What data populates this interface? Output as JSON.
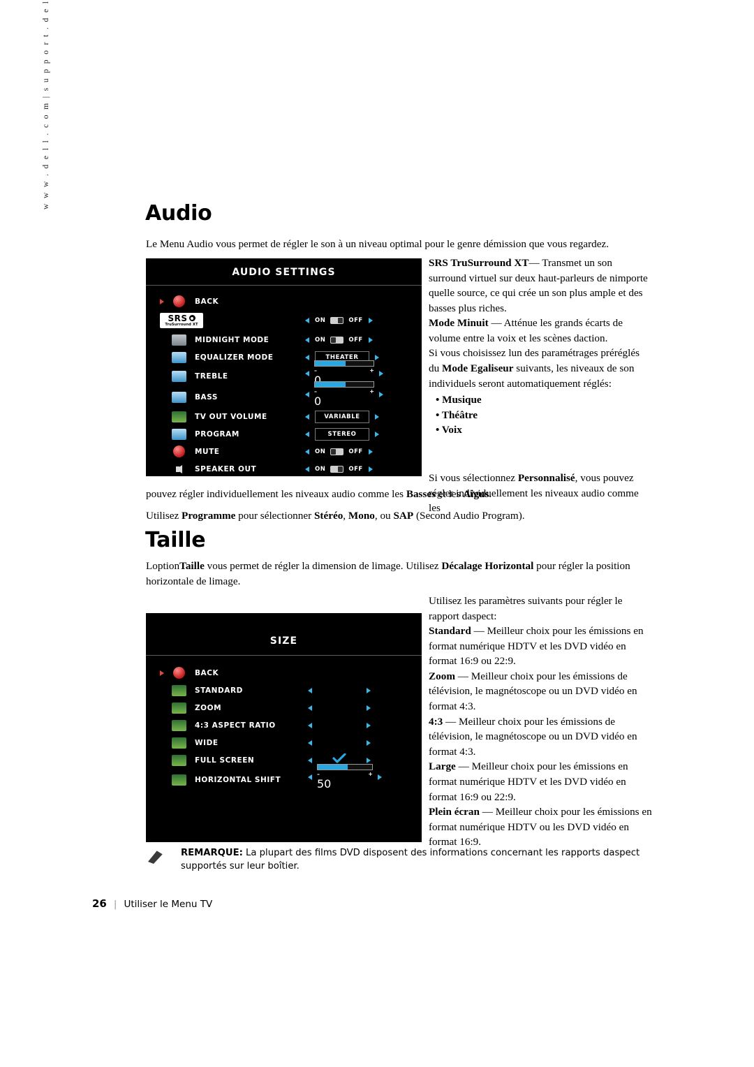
{
  "side_url": "w w w . d e l l . c o m  |  s u p p o r t . d e l l . c o m",
  "sections": {
    "audio": {
      "heading": "Audio",
      "intro": "Le Menu Audio vous permet de régler le son à un niveau optimal pour le genre démission que vous regardez.",
      "osd": {
        "title": "AUDIO SETTINGS",
        "rows": [
          {
            "label": "BACK",
            "icon": "back-icon",
            "control": "none"
          },
          {
            "label": "",
            "icon": "srs-trusurround-logo",
            "control": "onoff",
            "value": "ON",
            "on_label": "ON",
            "off_label": "OFF"
          },
          {
            "label": "MIDNIGHT MODE",
            "icon": "midnight-mode-icon",
            "control": "onoff",
            "value": "OFF",
            "on_label": "ON",
            "off_label": "OFF"
          },
          {
            "label": "EQUALIZER MODE",
            "icon": "equalizer-icon",
            "control": "box",
            "value": "THEATER"
          },
          {
            "label": "TREBLE",
            "icon": "treble-icon",
            "control": "slider",
            "value": "0",
            "minus": "–",
            "plus": "+",
            "fill": 52
          },
          {
            "label": "BASS",
            "icon": "bass-icon",
            "control": "slider",
            "value": "0",
            "minus": "–",
            "plus": "+",
            "fill": 52
          },
          {
            "label": "TV OUT VOLUME",
            "icon": "tv-out-volume-icon",
            "control": "box",
            "value": "VARIABLE"
          },
          {
            "label": "PROGRAM",
            "icon": "program-icon",
            "control": "box",
            "value": "STEREO"
          },
          {
            "label": "MUTE",
            "icon": "mute-icon",
            "control": "onoff",
            "value": "OFF",
            "on_label": "ON",
            "off_label": "OFF"
          },
          {
            "label": "SPEAKER OUT",
            "icon": "speaker-out-icon",
            "control": "onoff",
            "value": "ON",
            "on_label": "ON",
            "off_label": "OFF"
          }
        ]
      },
      "right_col": {
        "p1_bold": "SRS TruSurround XT",
        "p1_rest": "— Transmet un son surround virtuel sur deux haut-parleurs de nimporte quelle source, ce qui crée un son plus ample et des basses plus riches.",
        "p2_bold": "Mode Minuit",
        "p2_rest": "— Atténue les grands écarts de volume entre la voix et les scènes daction.",
        "p3_pre": "Si vous choisissez lun des paramétrages préréglés du ",
        "p3_bold": "Mode Egaliseur",
        "p3_post": " suivants, les niveaux de son individuels seront automatiquement réglés:",
        "bullets": [
          "Musique",
          "Théâtre",
          "Voix"
        ]
      },
      "after": {
        "l1_pre": "Si vous sélectionnez ",
        "l1_bold": "Personnalisé",
        "l1_post": ", vous pouvez régler individuellement les niveaux audio comme les ",
        "l1_bold2": "Basses",
        "l1_mid": " et les ",
        "l1_bold3": "Aigus",
        "l1_end": ".",
        "l2_pre": "Utilisez ",
        "l2_bold": "Programme",
        "l2_mid": " pour sélectionner ",
        "l2_b1": "Stéréo",
        "l2_sep1": ", ",
        "l2_b2": "Mono",
        "l2_sep2": ", ou ",
        "l2_b3": "SAP",
        "l2_end": " (Second Audio Program)."
      }
    },
    "taille": {
      "heading": "Taille",
      "intro_pre": "Loption",
      "intro_b1": "Taille",
      "intro_mid": " vous permet de régler la dimension de limage. Utilisez ",
      "intro_b2": "Décalage Horizontal",
      "intro_post": " pour régler la position horizontale de limage.",
      "osd": {
        "title": "SIZE",
        "rows": [
          {
            "label": "BACK",
            "icon": "back-icon",
            "control": "none"
          },
          {
            "label": "STANDARD",
            "icon": "standard-icon",
            "control": "arrows"
          },
          {
            "label": "ZOOM",
            "icon": "zoom-icon",
            "control": "arrows"
          },
          {
            "label": "4:3 ASPECT RATIO",
            "icon": "aspect-ratio-icon",
            "control": "arrows"
          },
          {
            "label": "WIDE",
            "icon": "wide-icon",
            "control": "arrows"
          },
          {
            "label": "FULL SCREEN",
            "icon": "full-screen-icon",
            "control": "arrows-check"
          },
          {
            "label": "HORIZONTAL SHIFT",
            "icon": "horizontal-shift-icon",
            "control": "slider",
            "value": "50",
            "minus": "–",
            "plus": "+",
            "fill": 55
          }
        ]
      },
      "right_col": {
        "intro": "Utilisez les paramètres suivants pour régler le rapport daspect:",
        "items": [
          {
            "bold": "Standard",
            "rest": "— Meilleur choix pour les émissions en format numérique HDTV et les DVD vidéo en format 16:9 ou 22:9."
          },
          {
            "bold": "Zoom",
            "rest": "— Meilleur choix pour les émissions de télévision, le magnétoscope ou un DVD vidéo en format 4:3."
          },
          {
            "bold": "4:3",
            "rest": "— Meilleur choix pour les émissions de télévision, le magnétoscope ou un DVD vidéo en format 4:3."
          },
          {
            "bold": "Large",
            "rest": "— Meilleur choix pour les émissions en format numérique HDTV et les DVD vidéo en format 16:9 ou 22:9."
          },
          {
            "bold": "Plein écran",
            "rest": "— Meilleur choix pour les émissions en format numérique HDTV ou les DVD vidéo en format 16:9."
          }
        ]
      }
    }
  },
  "note": {
    "label": "REMARQUE:",
    "text": " La plupart des films DVD disposent des informations concernant les rapports daspect supportés sur leur boîtier."
  },
  "footer": {
    "page_number": "26",
    "title": "Utiliser le Menu TV"
  },
  "colors": {
    "accent_blue": "#3ab7e8",
    "osd_bg": "#000000",
    "check_blue": "#2aa7e0"
  }
}
